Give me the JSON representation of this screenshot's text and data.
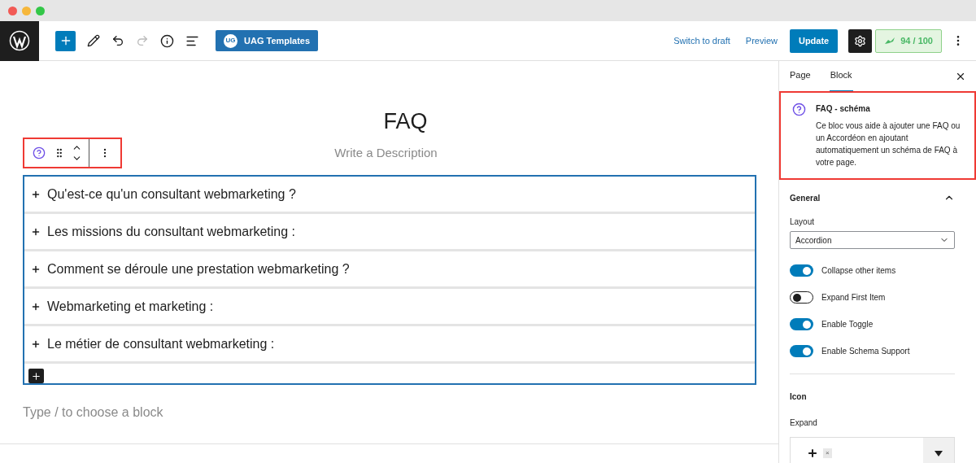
{
  "toolbar": {
    "templates_button": "UAG Templates",
    "templates_badge": "UG",
    "switch_to_draft": "Switch to draft",
    "preview": "Preview",
    "update": "Update",
    "score": "94 / 100"
  },
  "editor": {
    "title": "FAQ",
    "description_placeholder": "Write a Description",
    "faq_items": [
      {
        "question": "Qu'est-ce qu'un consultant webmarketing ?"
      },
      {
        "question": "Les missions du consultant webmarketing :"
      },
      {
        "question": "Comment se déroule une prestation webmarketing ?"
      },
      {
        "question": "Webmarketing et marketing :"
      },
      {
        "question": "Le métier de consultant webmarketing :"
      }
    ],
    "block_placeholder": "Type / to choose a block"
  },
  "sidebar": {
    "tabs": [
      {
        "label": "Page",
        "selected": false
      },
      {
        "label": "Block",
        "selected": true
      }
    ],
    "block_card": {
      "title": "FAQ - schéma",
      "description": "Ce bloc vous aide à ajouter une FAQ ou un Accordéon en ajoutant automatiquement un schéma de FAQ à votre page."
    },
    "general": {
      "heading": "General",
      "expanded": true,
      "layout_label": "Layout",
      "layout_value": "Accordion",
      "toggles": [
        {
          "label": "Collapse other items",
          "on": true
        },
        {
          "label": "Expand First Item",
          "on": false
        },
        {
          "label": "Enable Toggle",
          "on": true
        },
        {
          "label": "Enable Schema Support",
          "on": true
        }
      ]
    },
    "icon": {
      "heading": "Icon",
      "expand_label": "Expand",
      "remove_chip": "×"
    }
  }
}
